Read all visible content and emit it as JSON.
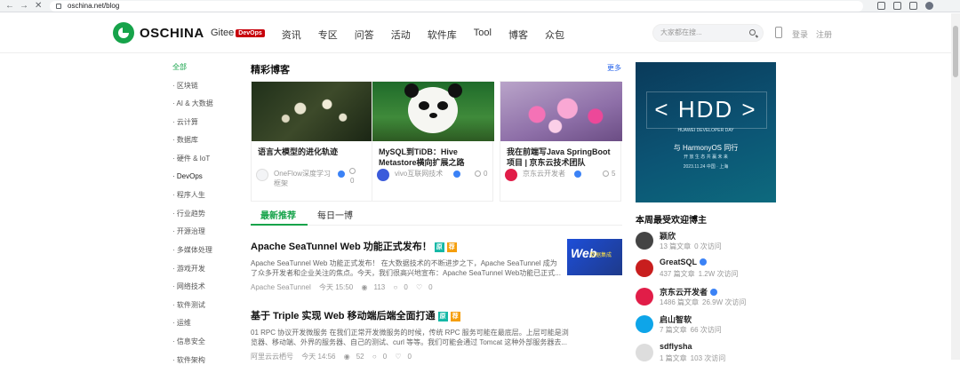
{
  "browser": {
    "url": "oschina.net/blog"
  },
  "header": {
    "logo_text": "OSCHINA",
    "nav": [
      "Gitee",
      "资讯",
      "专区",
      "问答",
      "活动",
      "软件库",
      "Tool",
      "博客",
      "众包"
    ],
    "devops_badge": "DevOps",
    "search_placeholder": "大家都在搜...",
    "login": "登录",
    "register": "注册"
  },
  "sidebar": {
    "items": [
      "全部",
      "· 区块链",
      "· AI & 大数据",
      "· 云计算",
      "· 数据库",
      "· 硬件 & IoT",
      "· DevOps",
      "· 程序人生",
      "· 行业趋势",
      "· 开源治理",
      "· 多媒体处理",
      "· 游戏开发",
      "· 网络技术",
      "· 软件测试",
      "· 运维",
      "· 信息安全",
      "· 软件架构"
    ]
  },
  "featured": {
    "title": "精彩博客",
    "more": "更多",
    "cards": [
      {
        "title": "语言大模型的进化轨迹",
        "author": "OneFlow深度学习框架",
        "comments": "0"
      },
      {
        "title": "MySQL到TiDB：Hive Metastore横向扩展之路",
        "author": "vivo互联网技术",
        "comments": "0"
      },
      {
        "title": "我在前端写Java SpringBoot项目 | 京东云技术团队",
        "author": "京东云开发者",
        "comments": "5"
      }
    ]
  },
  "tabs": {
    "latest": "最新推荐",
    "daily": "每日一博"
  },
  "articles": [
    {
      "title": "Apache SeaTunnel Web 功能正式发布！",
      "tag_original": "原",
      "tag_recommend": "荐",
      "summary": "Apache SeaTunnel Web 功能正式发布！ 在大数据技术的不断进步之下，Apache SeaTunnel 成为了众多开发者和企业关注的焦点。今天，我们很高兴地宣布：Apache SeaTunnel Web功能已正式...",
      "author": "Apache SeaTunnel",
      "time": "今天 15:50",
      "views": "113",
      "comments": "0",
      "likes": "0",
      "thumb_text": "Web",
      "thumb_sub": "数据集成"
    },
    {
      "title": "基于 Triple 实现 Web 移动端后端全面打通",
      "tag_original": "原",
      "tag_recommend": "荐",
      "summary": "01 RPC 协议开发微服务 在我们正常开发微服务的时候，传统 RPC 服务可能在最底层。上层可能是浏览器、移动端、外界的服务器、自己的测试、curl 等等。我们可能会通过 Tomcat 这种外部服务器去...",
      "author": "阿里云云栖号",
      "time": "今天 14:56",
      "views": "52",
      "comments": "0",
      "likes": "0"
    }
  ],
  "ad": {
    "headline": "< HDD >",
    "sub1": "HUAWEI DEVELOPER DAY",
    "sub2": "与 HarmonyOS 同行",
    "sub3": "开 放 生 态   共 赢 未 来",
    "sub4": "2023.11.24   中国 · 上海"
  },
  "popular": {
    "title": "本周最受欢迎博主",
    "bloggers": [
      {
        "name": "颖欣",
        "articles": "13 篇文章",
        "visits": "0 次访问",
        "color": "#444"
      },
      {
        "name": "GreatSQL",
        "articles": "437 篇文章",
        "visits": "1.2W 次访问",
        "color": "#c81e1e"
      },
      {
        "name": "京东云开发者",
        "articles": "1486 篇文章",
        "visits": "26.9W 次访问",
        "color": "#e11d48"
      },
      {
        "name": "启山智软",
        "articles": "7 篇文章",
        "visits": "66 次访问",
        "color": "#0ea5e9"
      },
      {
        "name": "sdflysha",
        "articles": "1 篇文章",
        "visits": "103 次访问",
        "color": "#ddd"
      }
    ]
  }
}
